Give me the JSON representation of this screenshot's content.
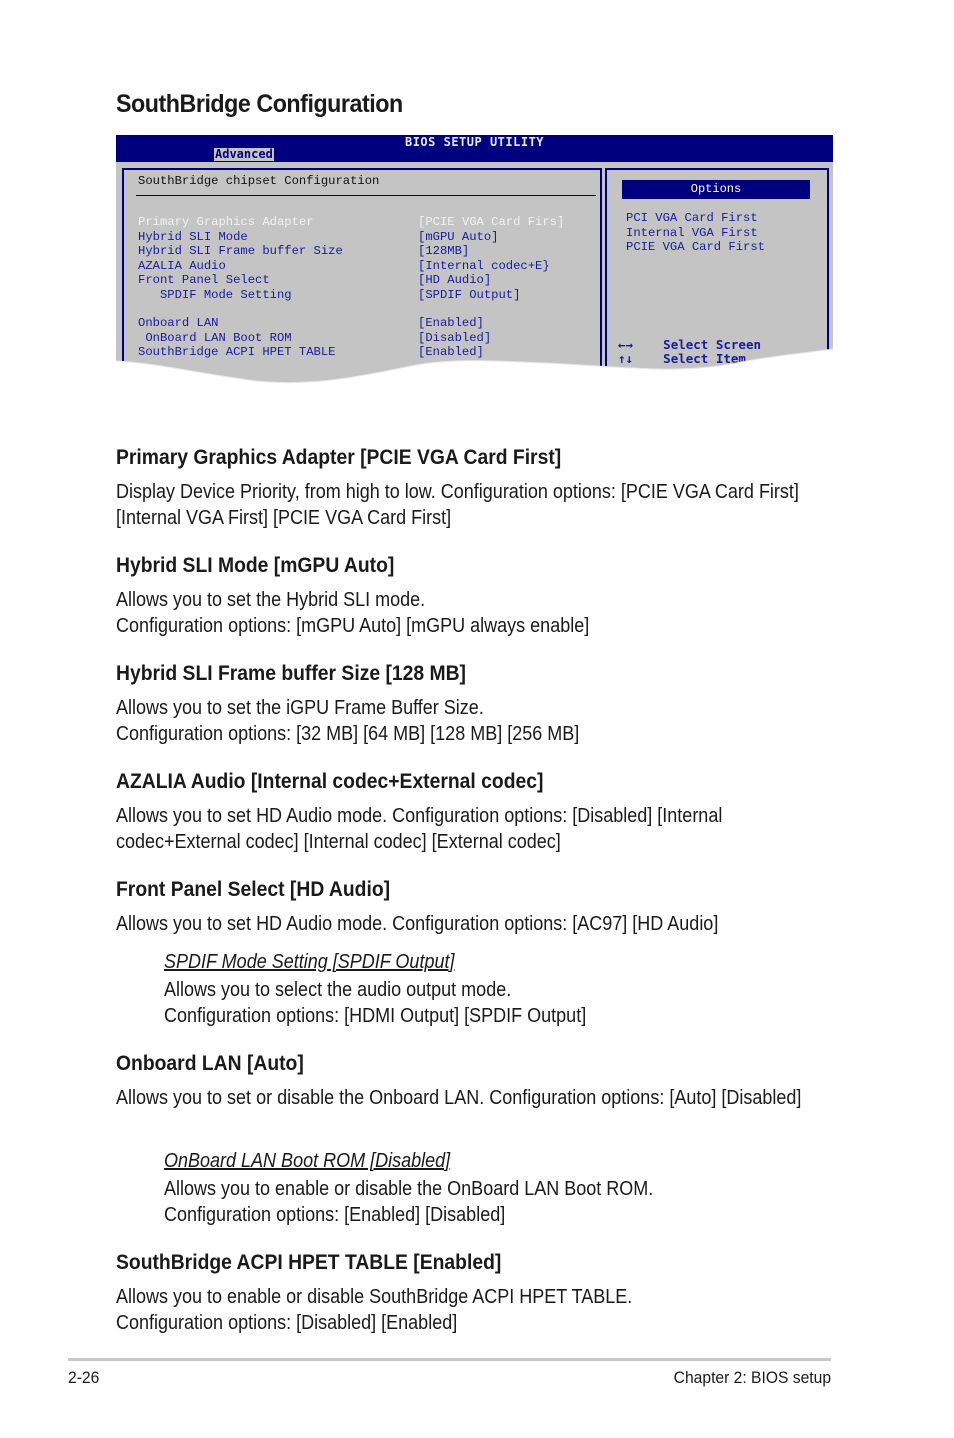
{
  "page": {
    "title": "SouthBridge Configuration"
  },
  "bios": {
    "title": "BIOS SETUP UTILITY",
    "active_tab": "Advanced",
    "section_title": "SouthBridge chipset Configuration",
    "items": [
      {
        "label": "Primary Graphics Adapter",
        "value": "[PCIE VGA Card Firs]",
        "selected": true
      },
      {
        "label": "Hybrid SLI Mode",
        "value": "[mGPU Auto]"
      },
      {
        "label": "Hybrid SLI Frame buffer Size",
        "value": "[128MB]"
      },
      {
        "label": "AZALIA Audio",
        "value": "[Internal codec+E}"
      },
      {
        "label": "Front Panel Select",
        "value": "[HD Audio]"
      },
      {
        "label": "   SPDIF Mode Setting",
        "value": "[SPDIF Output]"
      },
      {
        "label": "Onboard LAN",
        "value": "[Enabled]"
      },
      {
        "label": " OnBoard LAN Boot ROM",
        "value": "[Disabled]"
      },
      {
        "label": "SouthBridge ACPI HPET TABLE",
        "value": "[Enabled]"
      }
    ],
    "options_header": "Options",
    "options": [
      "PCI VGA Card First",
      "Internal VGA First",
      "PCIE VGA Card First"
    ],
    "help": [
      {
        "key": "←→",
        "action": "Select Screen"
      },
      {
        "key": "↑↓",
        "action": "Select Item"
      }
    ]
  },
  "sections": [
    {
      "heading": "Primary Graphics Adapter [PCIE VGA Card First]",
      "text": "Display Device Priority, from high to low. Configuration options: [PCIE VGA Card First] [Internal VGA First] [PCIE VGA Card First]"
    },
    {
      "heading": "Hybrid SLI Mode [mGPU Auto]",
      "line1": "Allows you to set the Hybrid SLI mode.",
      "line2": "Configuration options: [mGPU Auto] [mGPU always enable]"
    },
    {
      "heading": "Hybrid SLI Frame buffer Size [128 MB]",
      "line1": "Allows you to set the iGPU Frame Buffer Size.",
      "line2": "Configuration options: [32 MB] [64 MB] [128 MB] [256 MB]"
    },
    {
      "heading": "AZALIA Audio [Internal codec+External codec]",
      "text": "Allows you to set HD Audio mode. Configuration options: [Disabled] [Internal codec+External codec] [Internal codec] [External codec]"
    },
    {
      "heading": "Front Panel Select [HD Audio]",
      "text": "Allows you to set HD Audio mode. Configuration options: [AC97] [HD Audio]",
      "sub": {
        "heading": "SPDIF Mode Setting [SPDIF Output]",
        "line1": "Allows you to select the audio output mode.",
        "line2": "Configuration options: [HDMI Output] [SPDIF Output]"
      }
    },
    {
      "heading": "Onboard LAN [Auto]",
      "text": "Allows you to set or disable the Onboard LAN. Configuration options: [Auto] [Disabled]",
      "sub": {
        "heading": "OnBoard LAN Boot ROM [Disabled]",
        "line1": "Allows you to enable or disable the OnBoard LAN Boot ROM.",
        "line2": "Configuration options: [Enabled] [Disabled]"
      }
    },
    {
      "heading": "SouthBridge ACPI HPET TABLE [Enabled]",
      "line1": "Allows you to enable or disable SouthBridge ACPI HPET TABLE.",
      "line2": "Configuration options: [Disabled] [Enabled]"
    }
  ],
  "footer": {
    "page_number": "2-26",
    "chapter": "Chapter 2: BIOS setup"
  }
}
